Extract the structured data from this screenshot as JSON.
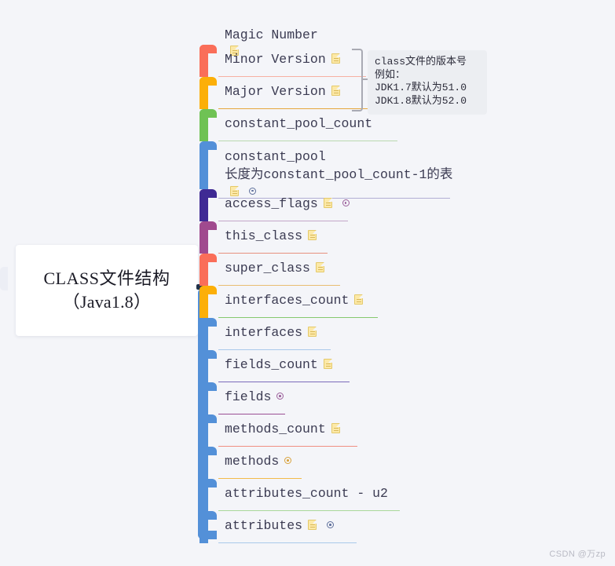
{
  "meta": {
    "background_color": "#f4f5f9",
    "watermark": "CSDN @万zp"
  },
  "root": {
    "line1": "CLASS文件结构",
    "line2": "（Java1.8）"
  },
  "tooltip": {
    "lines": [
      "class文件的版本号",
      "例如：",
      "JDK1.7默认为51.0",
      "JDK1.8默认为52.0"
    ]
  },
  "icons": {
    "note": "note-icon",
    "target": "target-icon"
  },
  "nodes": [
    {
      "label": "Magic Number",
      "bar_color": "",
      "underline_color": "",
      "has_note": true,
      "has_target": false
    },
    {
      "label": "Minor Version",
      "bar_color": "#fa6e59",
      "underline_color": "#f6b0a3",
      "has_note": true,
      "has_target": false
    },
    {
      "label": "Major Version",
      "bar_color": "#fcaf08",
      "underline_color": "#e5a63c",
      "has_note": true,
      "has_target": false
    },
    {
      "label": "constant_pool_count",
      "bar_color": "#6fc254",
      "underline_color": "#b9d9b0",
      "has_note": false,
      "has_target": false
    },
    {
      "label": "constant_pool",
      "label2": "长度为constant_pool_count-1的表",
      "bar_color": "#5390d8",
      "underline_color": "#b2aed4",
      "has_note": true,
      "has_target": true
    },
    {
      "label": "access_flags",
      "bar_color": "#3f2a94",
      "underline_color": "#c3a6c8",
      "has_note": true,
      "has_target": true
    },
    {
      "label": "this_class",
      "bar_color": "#a04a8e",
      "underline_color": "#e6907f",
      "has_note": true,
      "has_target": false
    },
    {
      "label": "super_class",
      "bar_color": "#fa6e59",
      "underline_color": "#e8bd72",
      "has_note": true,
      "has_target": false
    },
    {
      "label": "interfaces_count",
      "bar_color": "#fcaf08",
      "underline_color": "#86c96e",
      "has_note": true,
      "has_target": false
    },
    {
      "label": "interfaces",
      "bar_color": "#5390d8",
      "underline_color": "#a9c9ea",
      "has_note": true,
      "has_target": false
    },
    {
      "label": "fields_count",
      "bar_color": "#5390d8",
      "underline_color": "#7a6bbb",
      "has_note": true,
      "has_target": false
    },
    {
      "label": "fields",
      "bar_color": "#5390d8",
      "underline_color": "#9b4f95",
      "has_note": false,
      "has_target": true
    },
    {
      "label": "methods_count",
      "bar_color": "#5390d8",
      "underline_color": "#f08f82",
      "has_note": true,
      "has_target": false
    },
    {
      "label": "methods",
      "bar_color": "#5390d8",
      "underline_color": "#f3bb4a",
      "has_note": false,
      "has_target": true
    },
    {
      "label": "attributes_count - u2",
      "bar_color": "#5390d8",
      "underline_color": "#a9d79a",
      "has_note": false,
      "has_target": false
    },
    {
      "label": "attributes",
      "bar_color": "#5390d8",
      "underline_color": "#a9c9ea",
      "has_note": true,
      "has_target": true
    }
  ]
}
